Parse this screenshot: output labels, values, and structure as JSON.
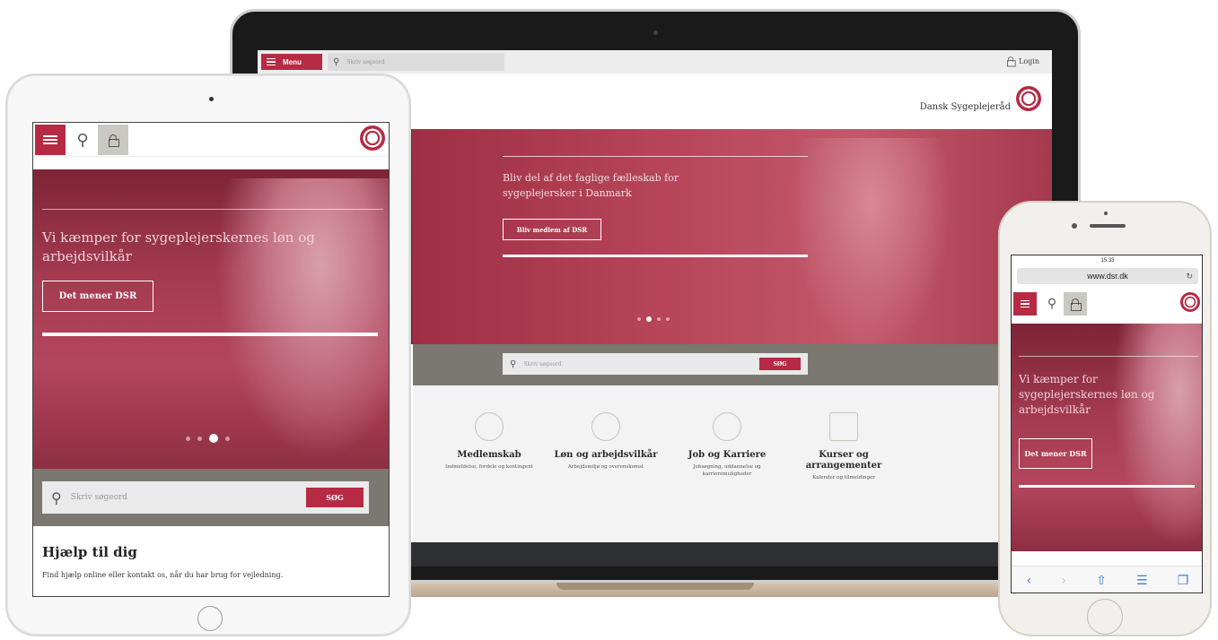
{
  "laptop": {
    "menu_label": "Menu",
    "search_placeholder": "Skriv søgeord",
    "login_label": "Login",
    "org_name": "Dansk Sygeplejeråd",
    "hero": {
      "headline": "Bliv del af det faglige fælleskab for sygeplejersker i Danmark",
      "cta": "Bliv medlem af DSR",
      "slide_dots": 4,
      "active_slide": 2
    },
    "search_band": {
      "placeholder": "Skriv søgeord",
      "button": "SØG"
    },
    "tiles": [
      {
        "title": "Medlemskab",
        "subtitle": "Indmeldelse, fordele og kontingent",
        "icon": "piggybank-icon"
      },
      {
        "title": "Løn og arbejdsvilkår",
        "subtitle": "Arbejdsmiljø og overenskomst",
        "icon": "coins-icon"
      },
      {
        "title": "Job og Karriere",
        "subtitle": "Jobsøgning, uddannelse og karrieremuligheder",
        "icon": "nurse-icon"
      },
      {
        "title": "Kurser og arrangementer",
        "subtitle": "Kalender og tilmeldinger",
        "icon": "calendar-icon"
      }
    ]
  },
  "tablet": {
    "hero": {
      "headline": "Vi kæmper for sygeplejerskernes løn og arbejdsvilkår",
      "cta": "Det mener DSR",
      "slide_dots": 4,
      "active_slide": 3
    },
    "search_band": {
      "placeholder": "Skriv søgeord",
      "button": "SØG"
    },
    "help_title": "Hjælp til dig",
    "help_text": "Find hjælp online eller kontakt os, når du har brug for vejledning."
  },
  "phone": {
    "status_time": "15.33",
    "url": "www.dsr.dk",
    "hero": {
      "headline": "Vi kæmper for sygeplejerskernes løn og arbejdsvilkår",
      "cta": "Det mener DSR"
    },
    "toolbar": [
      "back-icon",
      "forward-icon",
      "share-icon",
      "bookmarks-icon",
      "tabs-icon"
    ]
  },
  "colors": {
    "brand_red": "#b72a44",
    "band_grey": "#7a7870",
    "footer_dark": "#2d2f33"
  }
}
